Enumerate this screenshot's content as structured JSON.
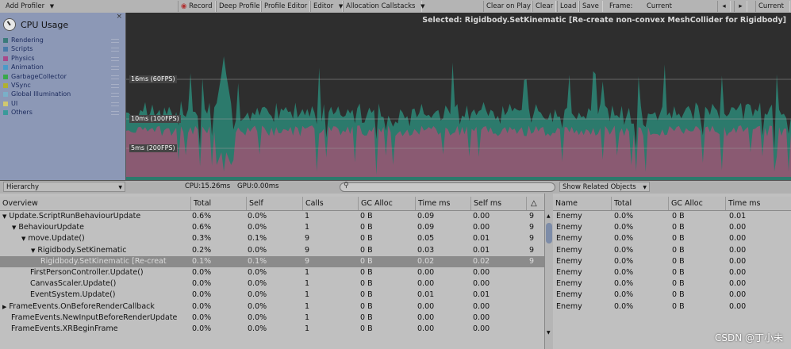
{
  "toolbar": {
    "add_profiler": "Add Profiler",
    "record": "Record",
    "deep_profile": "Deep Profile",
    "profile_editor": "Profile Editor",
    "editor": "Editor",
    "allocation_callstacks": "Allocation Callstacks",
    "clear_on_play": "Clear on Play",
    "clear": "Clear",
    "load": "Load",
    "save": "Save",
    "frame_label": "Frame:",
    "frame_value": "Current",
    "current": "Current"
  },
  "legend": {
    "title": "CPU Usage",
    "items": [
      {
        "label": "Rendering",
        "color": "#3a7a7a"
      },
      {
        "label": "Scripts",
        "color": "#4a7aa8"
      },
      {
        "label": "Physics",
        "color": "#a84a8a"
      },
      {
        "label": "Animation",
        "color": "#4a9ac8"
      },
      {
        "label": "GarbageCollector",
        "color": "#3aa84a"
      },
      {
        "label": "VSync",
        "color": "#b0b030"
      },
      {
        "label": "Global Illumination",
        "color": "#7ab0c8"
      },
      {
        "label": "UI",
        "color": "#d0c870"
      },
      {
        "label": "Others",
        "color": "#3a9a9a"
      }
    ]
  },
  "chart": {
    "selected_text": "Selected: Rigidbody.SetKinematic [Re-create non-convex MeshCollider for Rigidbody]",
    "gridlines": [
      "16ms (60FPS)",
      "10ms (100FPS)",
      "5ms (200FPS)"
    ],
    "colors": {
      "scripts": "#8a5a72",
      "others": "#2c7a6c",
      "background": "#2e2e2e"
    }
  },
  "midbar": {
    "view": "Hierarchy",
    "cpu": "CPU:15.26ms",
    "gpu": "GPU:0.00ms",
    "related": "Show Related Objects"
  },
  "left_table": {
    "columns": [
      "Overview",
      "Total",
      "Self",
      "Calls",
      "GC Alloc",
      "Time ms",
      "Self ms"
    ],
    "rows": [
      {
        "name": "Update.ScriptRunBehaviourUpdate",
        "indent": 0,
        "tri": "▼",
        "total": "0.6%",
        "self": "0.0%",
        "calls": "1",
        "gc": "0 B",
        "time": "0.09",
        "selfms": "0.00",
        "warn": "9"
      },
      {
        "name": "BehaviourUpdate",
        "indent": 1,
        "tri": "▼",
        "total": "0.6%",
        "self": "0.0%",
        "calls": "1",
        "gc": "0 B",
        "time": "0.09",
        "selfms": "0.00",
        "warn": "9"
      },
      {
        "name": "move.Update()",
        "indent": 2,
        "tri": "▼",
        "total": "0.3%",
        "self": "0.1%",
        "calls": "9",
        "gc": "0 B",
        "time": "0.05",
        "selfms": "0.01",
        "warn": "9"
      },
      {
        "name": "Rigidbody.SetKinematic",
        "indent": 3,
        "tri": "▼",
        "total": "0.2%",
        "self": "0.0%",
        "calls": "9",
        "gc": "0 B",
        "time": "0.03",
        "selfms": "0.01",
        "warn": "9"
      },
      {
        "name": "Rigidbody.SetKinematic [Re-creat",
        "indent": 4,
        "tri": "",
        "total": "0.1%",
        "self": "0.1%",
        "calls": "9",
        "gc": "0 B",
        "time": "0.02",
        "selfms": "0.02",
        "warn": "9",
        "selected": true
      },
      {
        "name": "FirstPersonController.Update()",
        "indent": 2,
        "tri": "",
        "total": "0.0%",
        "self": "0.0%",
        "calls": "1",
        "gc": "0 B",
        "time": "0.00",
        "selfms": "0.00",
        "warn": ""
      },
      {
        "name": "CanvasScaler.Update()",
        "indent": 2,
        "tri": "",
        "total": "0.0%",
        "self": "0.0%",
        "calls": "1",
        "gc": "0 B",
        "time": "0.00",
        "selfms": "0.00",
        "warn": ""
      },
      {
        "name": "EventSystem.Update()",
        "indent": 2,
        "tri": "",
        "total": "0.0%",
        "self": "0.0%",
        "calls": "1",
        "gc": "0 B",
        "time": "0.01",
        "selfms": "0.01",
        "warn": ""
      },
      {
        "name": "FrameEvents.OnBeforeRenderCallback",
        "indent": 0,
        "tri": "▶",
        "total": "0.0%",
        "self": "0.0%",
        "calls": "1",
        "gc": "0 B",
        "time": "0.00",
        "selfms": "0.00",
        "warn": ""
      },
      {
        "name": "FrameEvents.NewInputBeforeRenderUpdate",
        "indent": 0,
        "tri": "",
        "total": "0.0%",
        "self": "0.0%",
        "calls": "1",
        "gc": "0 B",
        "time": "0.00",
        "selfms": "0.00",
        "warn": ""
      },
      {
        "name": "FrameEvents.XRBeginFrame",
        "indent": 0,
        "tri": "",
        "total": "0.0%",
        "self": "0.0%",
        "calls": "1",
        "gc": "0 B",
        "time": "0.00",
        "selfms": "0.00",
        "warn": ""
      }
    ]
  },
  "right_table": {
    "columns": [
      "Name",
      "Total",
      "GC Alloc",
      "Time ms"
    ],
    "rows": [
      {
        "name": "Enemy",
        "total": "0.0%",
        "gc": "0 B",
        "time": "0.01"
      },
      {
        "name": "Enemy",
        "total": "0.0%",
        "gc": "0 B",
        "time": "0.00"
      },
      {
        "name": "Enemy",
        "total": "0.0%",
        "gc": "0 B",
        "time": "0.00"
      },
      {
        "name": "Enemy",
        "total": "0.0%",
        "gc": "0 B",
        "time": "0.00"
      },
      {
        "name": "Enemy",
        "total": "0.0%",
        "gc": "0 B",
        "time": "0.00"
      },
      {
        "name": "Enemy",
        "total": "0.0%",
        "gc": "0 B",
        "time": "0.00"
      },
      {
        "name": "Enemy",
        "total": "0.0%",
        "gc": "0 B",
        "time": "0.00"
      },
      {
        "name": "Enemy",
        "total": "0.0%",
        "gc": "0 B",
        "time": "0.00"
      },
      {
        "name": "Enemy",
        "total": "0.0%",
        "gc": "0 B",
        "time": "0.00"
      }
    ]
  },
  "watermark": "CSDN @丁小未"
}
